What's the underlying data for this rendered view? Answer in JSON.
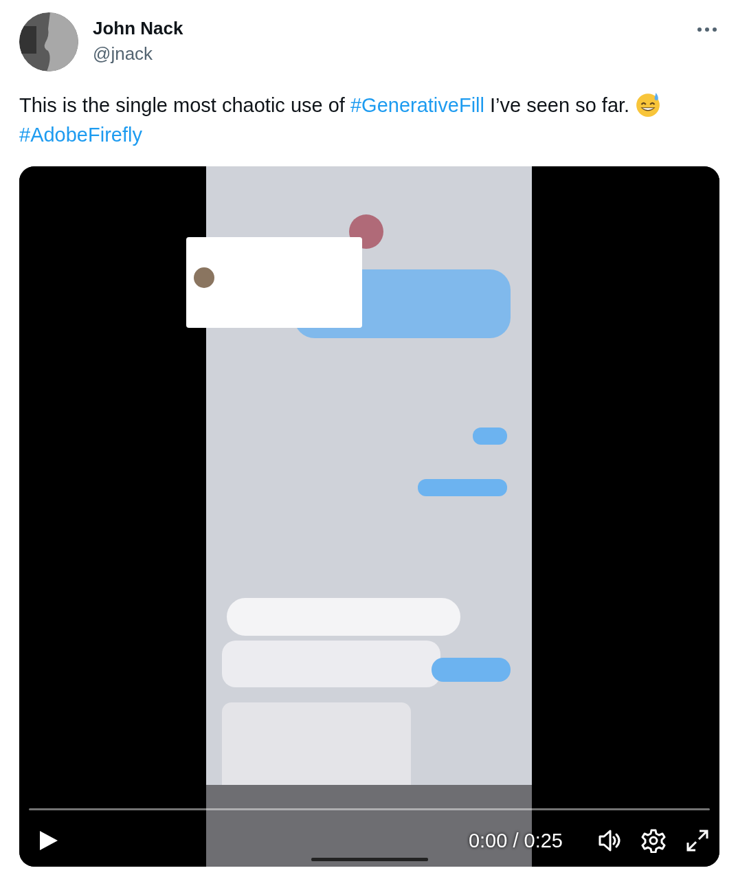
{
  "author": {
    "name": "John Nack",
    "handle": "@jnack"
  },
  "tweet": {
    "segments": [
      {
        "kind": "text",
        "text": "This is the single most chaotic use of "
      },
      {
        "kind": "hashtag",
        "text": "#GenerativeFill"
      },
      {
        "kind": "text",
        "text": " I’ve seen so far. "
      },
      {
        "kind": "emoji"
      },
      {
        "kind": "break"
      },
      {
        "kind": "hashtag",
        "text": "#AdobeFirefly"
      }
    ]
  },
  "video": {
    "kind": "picture",
    "time": "0:00 / 0:25"
  }
}
